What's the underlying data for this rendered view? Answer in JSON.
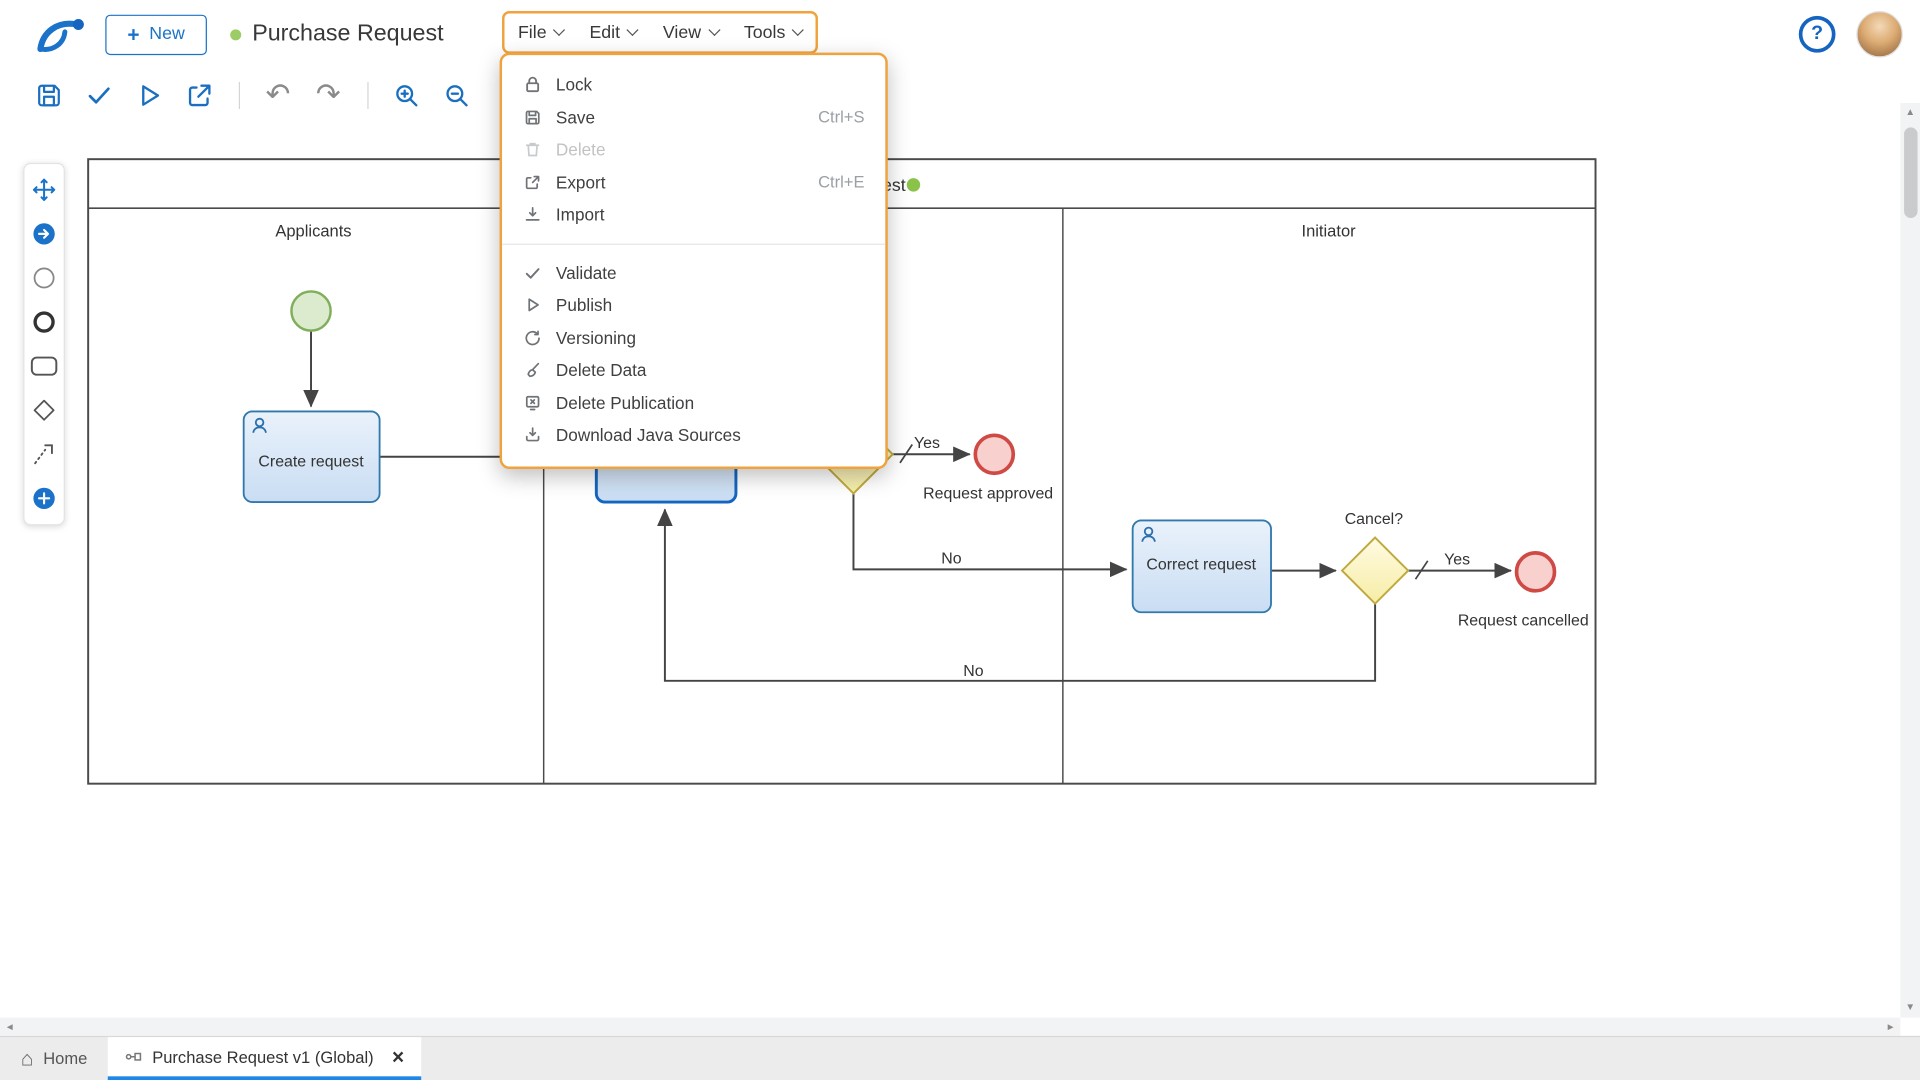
{
  "colors": {
    "accent_blue": "#1a73c9",
    "highlight_orange": "#f0a23c",
    "task_fill": "#d4e4f6",
    "task_border": "#3178ad",
    "start_event_border": "#7fae5c",
    "end_event_border": "#cf4a45",
    "gateway_border": "#bfa93e",
    "status_green": "#9ccc65"
  },
  "header": {
    "new_button": "New",
    "title": "Purchase Request",
    "menus": [
      {
        "label": "File"
      },
      {
        "label": "Edit"
      },
      {
        "label": "View"
      },
      {
        "label": "Tools"
      }
    ]
  },
  "toolbar": {
    "icons": [
      "save-icon",
      "validate-icon",
      "publish-icon",
      "export-icon",
      "undo-icon",
      "redo-icon",
      "zoom-in-icon",
      "zoom-out-icon"
    ]
  },
  "palette": {
    "tools": [
      "move-tool",
      "connect-tool",
      "start-event-tool",
      "end-event-tool",
      "task-tool",
      "gateway-tool",
      "annotation-connector-tool",
      "add-tool"
    ]
  },
  "file_menu": {
    "items": [
      {
        "label": "Lock",
        "shortcut": ""
      },
      {
        "label": "Save",
        "shortcut": "Ctrl+S"
      },
      {
        "label": "Delete",
        "shortcut": ""
      },
      {
        "label": "Export",
        "shortcut": "Ctrl+E"
      },
      {
        "label": "Import",
        "shortcut": ""
      },
      {
        "label": "Validate",
        "shortcut": ""
      },
      {
        "label": "Publish",
        "shortcut": ""
      },
      {
        "label": "Versioning",
        "shortcut": ""
      },
      {
        "label": "Delete Data",
        "shortcut": ""
      },
      {
        "label": "Delete Publication",
        "shortcut": ""
      },
      {
        "label": "Download Java Sources",
        "shortcut": ""
      }
    ]
  },
  "diagram": {
    "pool_title": "Purchase Request",
    "lane_labels": {
      "left": "Applicants",
      "middle": "",
      "right": "Initiator"
    },
    "tasks": {
      "create": "Create request",
      "correct": "Correct request"
    },
    "events": {
      "approved": "Request approved",
      "cancelled": "Request cancelled"
    },
    "gateways": {
      "cancel": "Cancel?"
    },
    "flows": {
      "yes1": "Yes",
      "no1": "No",
      "yes2": "Yes",
      "no2": "No"
    }
  },
  "tabs": {
    "home_label": "Home",
    "active_label": "Purchase Request v1 (Global)"
  }
}
